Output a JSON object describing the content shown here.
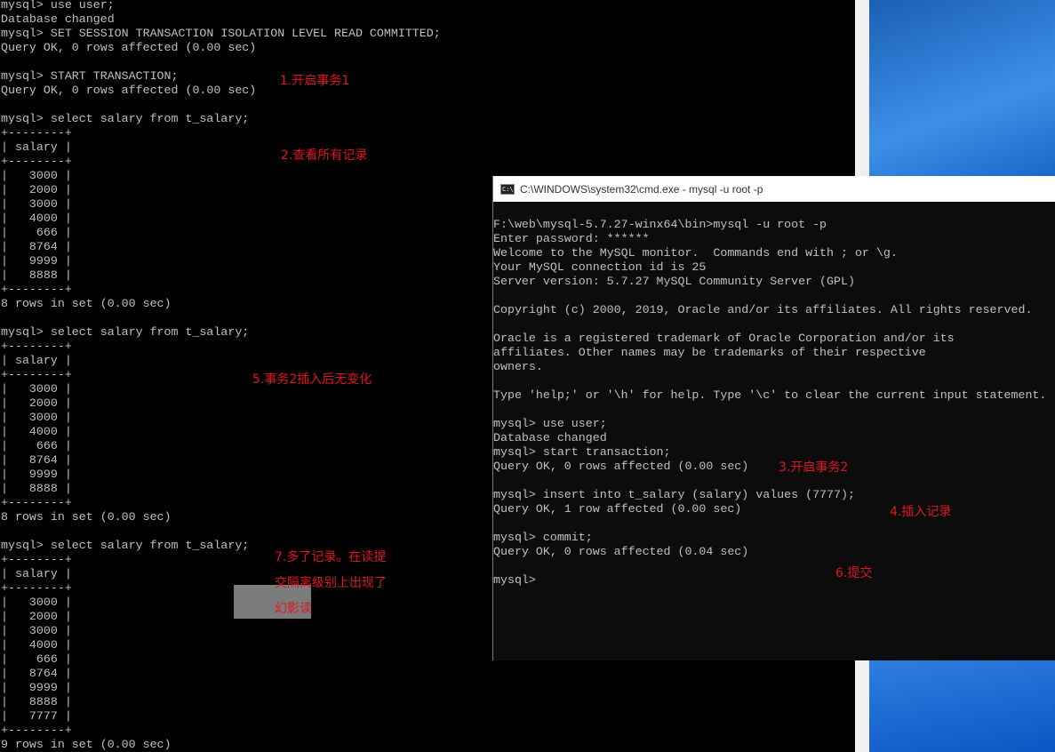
{
  "left_terminal": {
    "lines": [
      "mysql> use user;",
      "Database changed",
      "mysql> SET SESSION TRANSACTION ISOLATION LEVEL READ COMMITTED;",
      "Query OK, 0 rows affected (0.00 sec)",
      "",
      "mysql> START TRANSACTION;",
      "Query OK, 0 rows affected (0.00 sec)",
      "",
      "mysql> select salary from t_salary;",
      "+--------+",
      "| salary |",
      "+--------+",
      "|   3000 |",
      "|   2000 |",
      "|   3000 |",
      "|   4000 |",
      "|    666 |",
      "|   8764 |",
      "|   9999 |",
      "|   8888 |",
      "+--------+",
      "8 rows in set (0.00 sec)",
      "",
      "mysql> select salary from t_salary;",
      "+--------+",
      "| salary |",
      "+--------+",
      "|   3000 |",
      "|   2000 |",
      "|   3000 |",
      "|   4000 |",
      "|    666 |",
      "|   8764 |",
      "|   9999 |",
      "|   8888 |",
      "+--------+",
      "8 rows in set (0.00 sec)",
      "",
      "mysql> select salary from t_salary;",
      "+--------+",
      "| salary |",
      "+--------+",
      "|   3000 |",
      "|   2000 |",
      "|   3000 |",
      "|   4000 |",
      "|    666 |",
      "|   8764 |",
      "|   9999 |",
      "|   8888 |",
      "|   7777 |",
      "+--------+",
      "9 rows in set (0.00 sec)"
    ]
  },
  "annotations": {
    "a1": "1.开启事务1",
    "a2": "2.查看所有记录",
    "a5": "5.事务2插入后无变化",
    "a7": "7.多了记录。在读提\n交隔离级别上出现了\n幻影读",
    "a3": "3.开启事务2",
    "a4": "4.插入记录",
    "a6": "6.提交"
  },
  "cmd_window": {
    "title": "C:\\WINDOWS\\system32\\cmd.exe - mysql  -u root -p",
    "lines": [
      "F:\\web\\mysql-5.7.27-winx64\\bin>mysql -u root -p",
      "Enter password: ******",
      "Welcome to the MySQL monitor.  Commands end with ; or \\g.",
      "Your MySQL connection id is 25",
      "Server version: 5.7.27 MySQL Community Server (GPL)",
      "",
      "Copyright (c) 2000, 2019, Oracle and/or its affiliates. All rights reserved.",
      "",
      "Oracle is a registered trademark of Oracle Corporation and/or its",
      "affiliates. Other names may be trademarks of their respective",
      "owners.",
      "",
      "Type 'help;' or '\\h' for help. Type '\\c' to clear the current input statement.",
      "",
      "mysql> use user;",
      "Database changed",
      "mysql> start transaction;",
      "Query OK, 0 rows affected (0.00 sec)",
      "",
      "mysql> insert into t_salary (salary) values (7777);",
      "Query OK, 1 row affected (0.00 sec)",
      "",
      "mysql> commit;",
      "Query OK, 0 rows affected (0.04 sec)",
      "",
      "mysql>"
    ]
  }
}
